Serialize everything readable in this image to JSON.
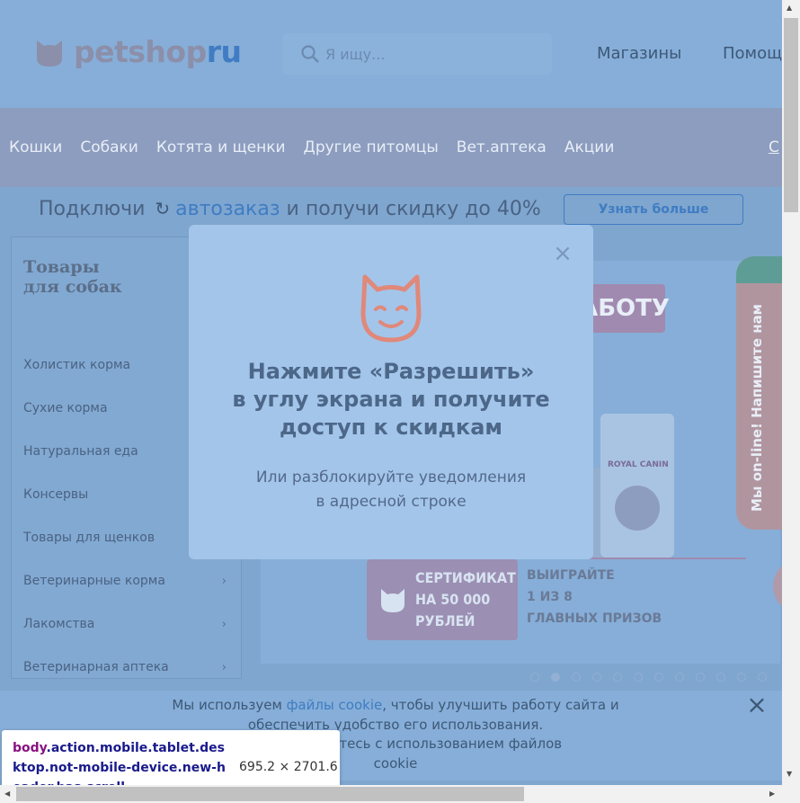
{
  "header": {
    "logo_main": "petshop",
    "logo_accent": "ru",
    "search_placeholder": "Я ищу...",
    "links": {
      "stores": "Магазины",
      "help": "Помощ"
    }
  },
  "nav": {
    "items": [
      "Кошки",
      "Собаки",
      "Котята и щенки",
      "Другие питомцы",
      "Вет.аптека",
      "Акции"
    ],
    "extra": "С"
  },
  "promo": {
    "text_before": "Подключи",
    "text_accent": "автозаказ",
    "text_after": " и получи скидку до 40%",
    "button": "Узнать больше"
  },
  "sidebar": {
    "title_line1": "Товары",
    "title_line2": "для собак",
    "items": [
      {
        "label": "Холистик корма",
        "chevron": false
      },
      {
        "label": "Сухие корма",
        "chevron": false
      },
      {
        "label": "Натуральная еда",
        "chevron": false
      },
      {
        "label": "Консервы",
        "chevron": false
      },
      {
        "label": "Товары для щенков",
        "chevron": false
      },
      {
        "label": "Ветеринарные корма",
        "chevron": true
      },
      {
        "label": "Лакомства",
        "chevron": true
      },
      {
        "label": "Ветеринарная аптека",
        "chevron": true
      }
    ]
  },
  "banner": {
    "headline_fragment": "АБОТУ",
    "bag_brand": "ROYAL CANIN",
    "cert_line1": "СЕРТИФИКАТ",
    "cert_line2": "НА 50 000",
    "cert_line3": "РУБЛЕЙ",
    "win_line1": "ВЫИГРАЙТЕ",
    "win_line2": "1 ИЗ 8",
    "win_line3": "ГЛАВНЫХ ПРИЗОВ",
    "dots_count": 12,
    "active_dot": 1
  },
  "chat": {
    "label": "Мы on-line! Напишите нам"
  },
  "modal": {
    "close_symbol": "×",
    "title": "Нажмите «Разрешить»\nв углу экрана и получите\nдоступ к скидкам",
    "subtitle": "Или разблокируйте уведомления\nв адресной строке"
  },
  "cookie": {
    "before": "Мы используем ",
    "link": "файлы cookie",
    "after": ", чтобы улучшить работу сайта и обеспечить удобство его использования.",
    "line3": "м, вы соглашаетесь с использованием файлов",
    "line4": "cookie",
    "close_symbol": "×"
  },
  "devtools_tooltip": {
    "tag": "body",
    "classes": ".action.mobile.tablet.desktop.not-mobile-device.new-header.has-scroll",
    "dimensions": "695.2 × 2701.6"
  },
  "colors": {
    "overlay": "#7fa6cf",
    "brand_blue": "#3f7cc3",
    "nav_bg": "#8d9dbf",
    "modal_bg": "#a3c5ea",
    "chat_accent": "#5e9d96"
  }
}
